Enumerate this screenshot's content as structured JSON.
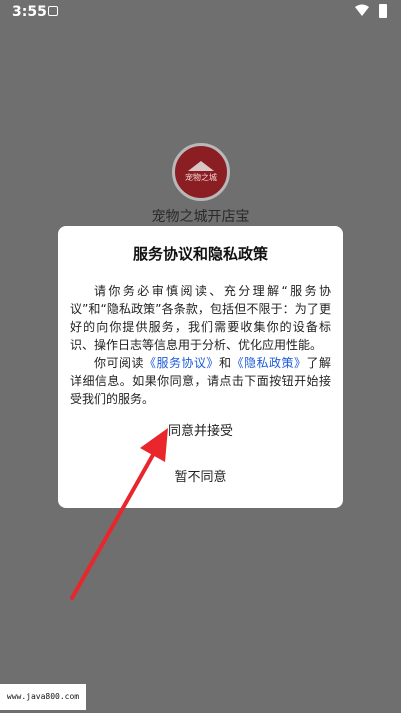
{
  "status_bar": {
    "time": "3:55"
  },
  "app": {
    "logo_text": "宠物之城",
    "name": "宠物之城开店宝"
  },
  "dialog": {
    "title": "服务协议和隐私政策",
    "para1": "请你务必审慎阅读、充分理解“服务协议”和“隐私政策”各条款，包括但不限于：为了更好的向你提供服务，我们需要收集你的设备标识、操作日志等信息用于分析、优化应用性能。",
    "para2_prefix": "你可阅读",
    "service_link": "《服务协议》",
    "and_text": "和",
    "privacy_link": "《隐私政策》",
    "para2_suffix": "了解详细信息。如果你同意，请点击下面按钮开始接受我们的服务。",
    "agree_label": "同意并接受",
    "disagree_label": "暂不同意"
  },
  "watermark": {
    "text": "www.java800.com"
  },
  "colors": {
    "overlay": "#6f6f6f",
    "link": "#1e5bd8",
    "arrow": "#e8262c",
    "logo": "#8b1e23"
  }
}
